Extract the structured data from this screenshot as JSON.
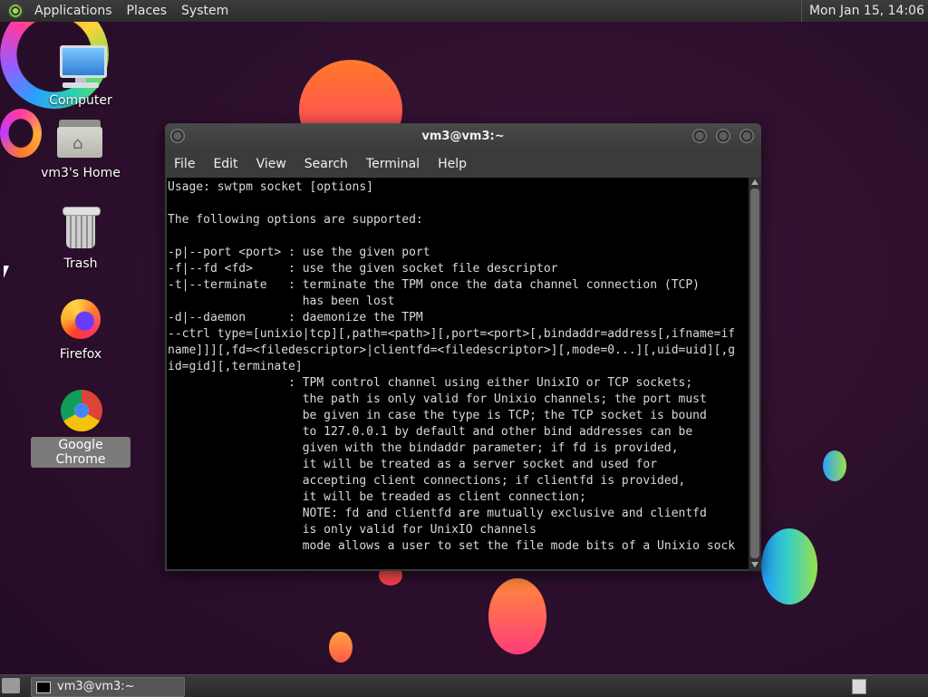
{
  "top_panel": {
    "menus": [
      "Applications",
      "Places",
      "System"
    ],
    "clock": "Mon Jan 15, 14:06"
  },
  "desktop_icons": [
    {
      "label": "Computer",
      "icon": "computer-icon"
    },
    {
      "label": "vm3's Home",
      "icon": "home-folder-icon"
    },
    {
      "label": "Trash",
      "icon": "trash-icon"
    },
    {
      "label": "Firefox",
      "icon": "firefox-icon"
    },
    {
      "label": "Google Chrome",
      "icon": "chrome-icon",
      "selected": true
    }
  ],
  "terminal": {
    "title": "vm3@vm3:~",
    "menu": [
      "File",
      "Edit",
      "View",
      "Search",
      "Terminal",
      "Help"
    ],
    "lines": [
      "Usage: swtpm socket [options]",
      "",
      "The following options are supported:",
      "",
      "-p|--port <port> : use the given port",
      "-f|--fd <fd>     : use the given socket file descriptor",
      "-t|--terminate   : terminate the TPM once the data channel connection (TCP)",
      "                   has been lost",
      "-d|--daemon      : daemonize the TPM",
      "--ctrl type=[unixio|tcp][,path=<path>][,port=<port>[,bindaddr=address[,ifname=if",
      "name]]][,fd=<filedescriptor>|clientfd=<filedescriptor>][,mode=0...][,uid=uid][,g",
      "id=gid][,terminate]",
      "                 : TPM control channel using either UnixIO or TCP sockets;",
      "                   the path is only valid for Unixio channels; the port must",
      "                   be given in case the type is TCP; the TCP socket is bound",
      "                   to 127.0.0.1 by default and other bind addresses can be",
      "                   given with the bindaddr parameter; if fd is provided,",
      "                   it will be treated as a server socket and used for",
      "                   accepting client connections; if clientfd is provided,",
      "                   it will be treaded as client connection;",
      "                   NOTE: fd and clientfd are mutually exclusive and clientfd",
      "                   is only valid for UnixIO channels",
      "                   mode allows a user to set the file mode bits of a Unixio sock",
      ""
    ],
    "prompt": ":"
  },
  "bottom_panel": {
    "task_label": "vm3@vm3:~"
  },
  "colors": {
    "terminal_bg": "#000000",
    "terminal_fg": "#d9d9d9",
    "panel_bg": "#333333",
    "wallpaper": "#2c0f2c"
  }
}
